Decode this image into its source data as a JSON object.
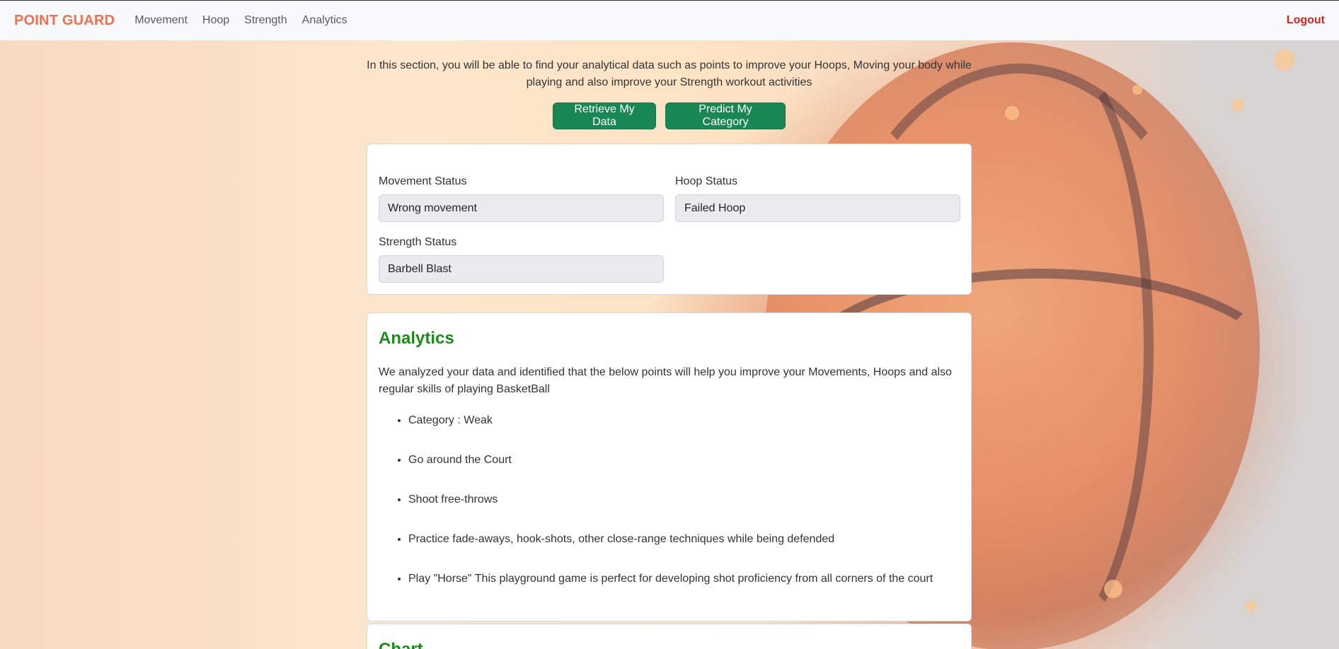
{
  "navbar": {
    "brand": "POINT GUARD",
    "links": [
      "Movement",
      "Hoop",
      "Strength",
      "Analytics"
    ],
    "logout": "Logout"
  },
  "intro": {
    "text": "In this section, you will be able to find your analytical data such as points to improve your Hoops, Moving your body while playing and also improve your Strength workout activities"
  },
  "buttons": {
    "retrieve": "Retrieve My Data",
    "predict": "Predict My Category"
  },
  "status": {
    "movement_label": "Movement Status",
    "movement_value": "Wrong movement",
    "hoop_label": "Hoop Status",
    "hoop_value": "Failed Hoop",
    "strength_label": "Strength Status",
    "strength_value": "Barbell Blast"
  },
  "analytics": {
    "title": "Analytics",
    "description": "We analyzed your data and identified that the below points will help you improve your Movements, Hoops and also regular skills of playing BasketBall",
    "items": [
      "Category : Weak",
      "Go around the Court",
      "Shoot free-throws",
      "Practice fade-aways, hook-shots, other close-range techniques while being defended",
      "Play \"Horse\" This playground game is perfect for developing shot proficiency from all corners of the court"
    ]
  },
  "chart": {
    "title": "Chart"
  },
  "colors": {
    "brand": "#f0704f",
    "logout": "#dc1f1f",
    "button": "#198754",
    "heading": "#1e8a1e"
  }
}
